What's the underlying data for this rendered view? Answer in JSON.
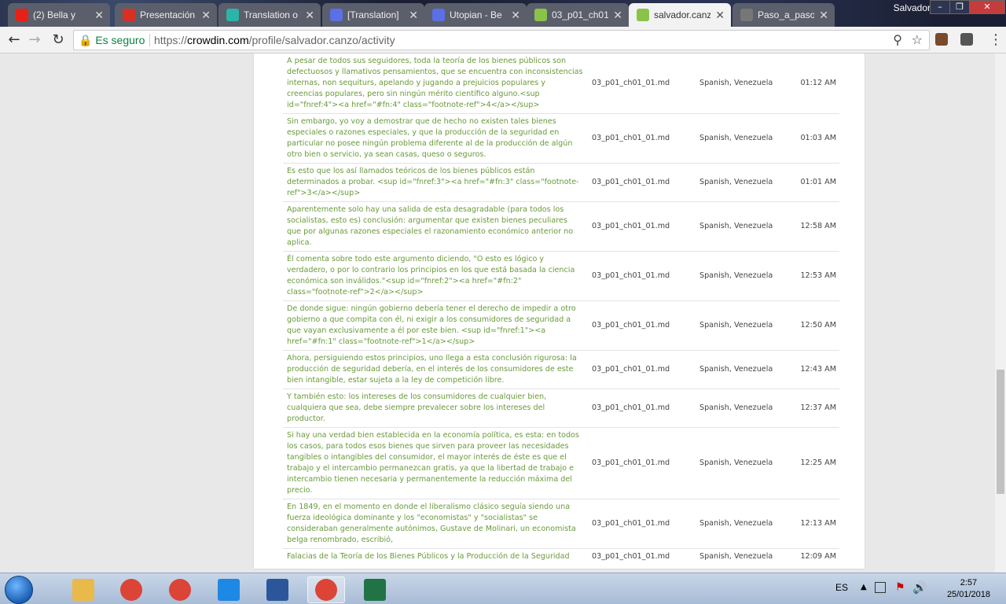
{
  "browser": {
    "profile_name": "Salvador",
    "tabs": [
      {
        "title": "(2) Bella y",
        "icon": "youtube-icon",
        "color": "#e62117",
        "active": false
      },
      {
        "title": "Presentación",
        "icon": "gmail-icon",
        "color": "#d93025",
        "active": false
      },
      {
        "title": "Translation o",
        "icon": "crowdin-icon",
        "color": "#2bb5a6",
        "active": false
      },
      {
        "title": "[Translation]",
        "icon": "utopian-icon",
        "color": "#5b6fe6",
        "active": false
      },
      {
        "title": "Utopian - Be",
        "icon": "utopian-icon",
        "color": "#5b6fe6",
        "active": false
      },
      {
        "title": "03_p01_ch01",
        "icon": "crowdin-icon",
        "color": "#8bc34a",
        "active": false
      },
      {
        "title": "salvador.canz",
        "icon": "crowdin-icon",
        "color": "#8bc34a",
        "active": true
      },
      {
        "title": "Paso_a_paso",
        "icon": "document-icon",
        "color": "#777",
        "active": false
      }
    ],
    "address": {
      "secure_label": "Es seguro",
      "url_scheme": "https://",
      "url_host": "crowdin.com",
      "url_path": "/profile/salvador.canzo/activity"
    }
  },
  "activity": {
    "rows": [
      {
        "text": "A pesar de todos sus seguidores, toda la teoría de los bienes públicos son defectuosos y llamativos pensamientos, que se encuentra con inconsistencias internas, non sequiturs, apelando y jugando a prejuicios populares y creencias populares, pero sin ningún mérito científico alguno.<sup id=\"fnref:4\"><a href=\"#fn:4\" class=\"footnote-ref\">4</a></sup>",
        "file": "03_p01_ch01_01.md",
        "language": "Spanish, Venezuela",
        "time": "01:12 AM"
      },
      {
        "text": "Sin embargo, yo voy a demostrar que de hecho no existen tales bienes especiales o razones especiales, y que la producción de la seguridad en particular no posee ningún problema diferente al de la producción de algún otro bien o servicio, ya sean casas, queso o seguros.",
        "file": "03_p01_ch01_01.md",
        "language": "Spanish, Venezuela",
        "time": "01:03 AM"
      },
      {
        "text": "Es esto que los así llamados teóricos de los bienes públicos están determinados a probar. <sup id=\"fnref:3\"><a href=\"#fn:3\" class=\"footnote-ref\">3</a></sup>",
        "file": "03_p01_ch01_01.md",
        "language": "Spanish, Venezuela",
        "time": "01:01 AM"
      },
      {
        "text": "Aparentemente solo hay una salida de esta desagradable (para todos los socialistas, esto es) conclusión: argumentar que existen bienes peculiares que por algunas razones especiales el razonamiento económico anterior no aplica.",
        "file": "03_p01_ch01_01.md",
        "language": "Spanish, Venezuela",
        "time": "12:58 AM"
      },
      {
        "text": "Él comenta sobre todo este argumento diciendo, \"O esto es lógico y verdadero, o por lo contrario los principios en los que está basada la ciencia económica son inválidos.\"<sup id=\"fnref:2\"><a href=\"#fn:2\" class=\"footnote-ref\">2</a></sup>",
        "file": "03_p01_ch01_01.md",
        "language": "Spanish, Venezuela",
        "time": "12:53 AM"
      },
      {
        "text": "De donde sigue: ningún gobierno debería tener el derecho de impedir a otro gobierno a que compita con él, ni exigir a los consumidores de seguridad a que vayan exclusivamente a él por este bien. <sup id=\"fnref:1\"><a href=\"#fn:1\" class=\"footnote-ref\">1</a></sup>",
        "file": "03_p01_ch01_01.md",
        "language": "Spanish, Venezuela",
        "time": "12:50 AM"
      },
      {
        "text": "Ahora, persiguiendo estos principios, uno llega a esta conclusión rigurosa: la producción de seguridad debería, en el interés de los consumidores de este bien intangible, estar sujeta a la ley de competición libre.",
        "file": "03_p01_ch01_01.md",
        "language": "Spanish, Venezuela",
        "time": "12:43 AM"
      },
      {
        "text": "Y también esto: los intereses de los consumidores de cualquier bien, cualquiera que sea, debe siempre prevalecer sobre los intereses del productor.",
        "file": "03_p01_ch01_01.md",
        "language": "Spanish, Venezuela",
        "time": "12:37 AM"
      },
      {
        "text": "Si hay una verdad bien establecida en la economía política, es esta: en todos los casos, para todos esos bienes que sirven para proveer las necesidades tangibles o intangibles del consumidor, el mayor interés de éste es que el trabajo y el intercambio permanezcan gratis, ya que la libertad de trabajo e intercambio tienen necesaria y permanentemente la reducción máxima del precio.",
        "file": "03_p01_ch01_01.md",
        "language": "Spanish, Venezuela",
        "time": "12:25 AM"
      },
      {
        "text": "En 1849, en el momento en donde el liberalismo clásico seguía siendo una fuerza ideológica dominante y los \"economistas\" y \"socialistas\" se consideraban generalmente autónimos, Gustave de Molinari, un economista belga renombrado, escribió,",
        "file": "03_p01_ch01_01.md",
        "language": "Spanish, Venezuela",
        "time": "12:13 AM"
      },
      {
        "text": "Falacias de la Teoría de los Bienes Públicos y la Producción de la Seguridad",
        "file": "03_p01_ch01_01.md",
        "language": "Spanish, Venezuela",
        "time": "12:09 AM"
      }
    ]
  },
  "taskbar": {
    "language": "ES",
    "time": "2:57",
    "date": "25/01/2018",
    "apps": [
      "explorer-icon",
      "chrome-icon",
      "chrome-icon",
      "internet-explorer-icon",
      "word-icon",
      "chrome-icon",
      "excel-icon"
    ]
  }
}
